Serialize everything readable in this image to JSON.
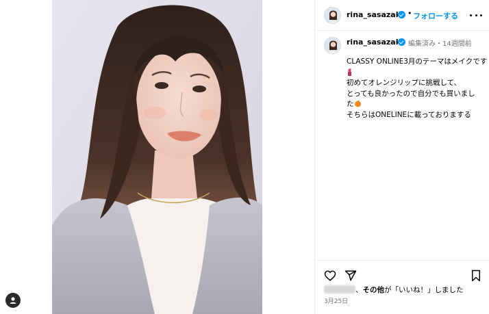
{
  "post": {
    "username": "rina_sasazaki",
    "follow_label": "フォローする",
    "separator": "•",
    "edited_label": "編集済み・14週間前",
    "caption_lines": [
      "CLASSY ONLINE3月のテーマはメイクです",
      "初めてオレンジリップに挑戦して、",
      "とっても良かったので自分でも買いまし",
      "た",
      "そちらはONELINEに載っておりまする"
    ],
    "likes_sep": "、",
    "likes_others": "その他",
    "likes_suffix": "が「いいね！」しました",
    "date": "3月25日"
  },
  "icons": {
    "more": "more-horizontal-icon",
    "verified": "verified-badge-icon",
    "heart": "heart-icon",
    "share": "share-icon",
    "save": "bookmark-icon",
    "profile": "profile-icon",
    "lipstick": "lipstick-emoji",
    "orange": "tangerine-emoji"
  },
  "colors": {
    "link_blue": "#0095f6",
    "muted": "#737373",
    "divider": "#efefef"
  }
}
